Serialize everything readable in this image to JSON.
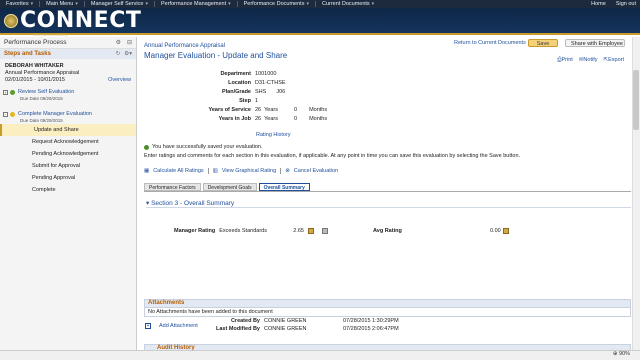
{
  "menubar": {
    "items": [
      "Favorites",
      "Main Menu",
      "Manager Self Service",
      "Performance Management",
      "Performance Documents",
      "Current Documents"
    ],
    "home": "Home",
    "signout": "Sign out"
  },
  "header": {
    "logo_text": "CONNECT",
    "logo_sub": "Maryland Judiciary"
  },
  "leftpanel": {
    "title": "Performance Process",
    "steps_header": "Steps and Tasks",
    "employee_name": "DEBORAH WHITAKER",
    "doc_type": "Annual Performance Appraisal",
    "period_start": "02/01/2015",
    "period_sep": "-",
    "period_end": "10/01/2015",
    "overview": "Overview",
    "step1": {
      "label": "Review Self Evaluation",
      "due_label": "Due Date",
      "due": "09/29/2015"
    },
    "step2": {
      "label": "Complete Manager Evaluation",
      "due_label": "Due Date",
      "due": "09/29/2015"
    },
    "substeps": [
      "Update and Share",
      "Request Acknowledgement",
      "Pending Acknowledgement",
      "Submit for Approval",
      "Pending Approval",
      "Complete"
    ]
  },
  "main": {
    "return_link": "Return to Current Documents",
    "save": "Save",
    "share": "Share with Employee",
    "doc_heading": "Annual Performance Appraisal",
    "page_title": "Manager Evaluation - Update and Share",
    "actions": {
      "print": "Print",
      "notify": "Notify",
      "export": "Export"
    },
    "fields": {
      "dept_label": "Department",
      "dept": "1001000",
      "loc_label": "Location",
      "loc": "D31-CTHSE",
      "plan_label": "Plan/Grade",
      "plan": "SHS",
      "grade": "J06",
      "step_label": "Step",
      "step": "1",
      "yos_label": "Years of Service",
      "yos": "26",
      "yos_unit": "Years",
      "yos_m": "0",
      "yos_m_unit": "Months",
      "yij_label": "Years in Job",
      "yij": "26",
      "yij_unit": "Years",
      "yij_m": "0",
      "yij_m_unit": "Months"
    },
    "rating_history": "Rating History",
    "success": "You have successfully saved your evaluation.",
    "instructions": "Enter ratings and comments for each section in this evaluation, if applicable. At any point in time you can save this evaluation by selecting the Save button.",
    "toolbar": {
      "calc": "Calculate All Ratings",
      "graph": "View Graphical Rating",
      "cancel": "Cancel Evaluation"
    },
    "tabs": [
      "Performance Factors",
      "Development Goals",
      "Overall Summary"
    ],
    "section_title": "Section 3 - Overall Summary",
    "manager_rating_label": "Manager Rating",
    "manager_rating": "Exceeds Standards",
    "manager_rating_num": "2.65",
    "avg_rating_label": "Avg Rating",
    "avg_rating": "0.00",
    "attachments_header": "Attachments",
    "attachments_empty": "No Attachments have been added to this document",
    "add_attachment": "Add Attachment",
    "audit_header": "Audit History",
    "created_label": "Created By",
    "created_by": "CONNIE GREEN",
    "created_at": "07/28/2015 1:30:29PM",
    "modified_label": "Last Modified By",
    "modified_by": "CONNIE GREEN",
    "modified_at": "07/28/2015 2:06:47PM"
  },
  "statusbar": {
    "zoom": "90%"
  }
}
